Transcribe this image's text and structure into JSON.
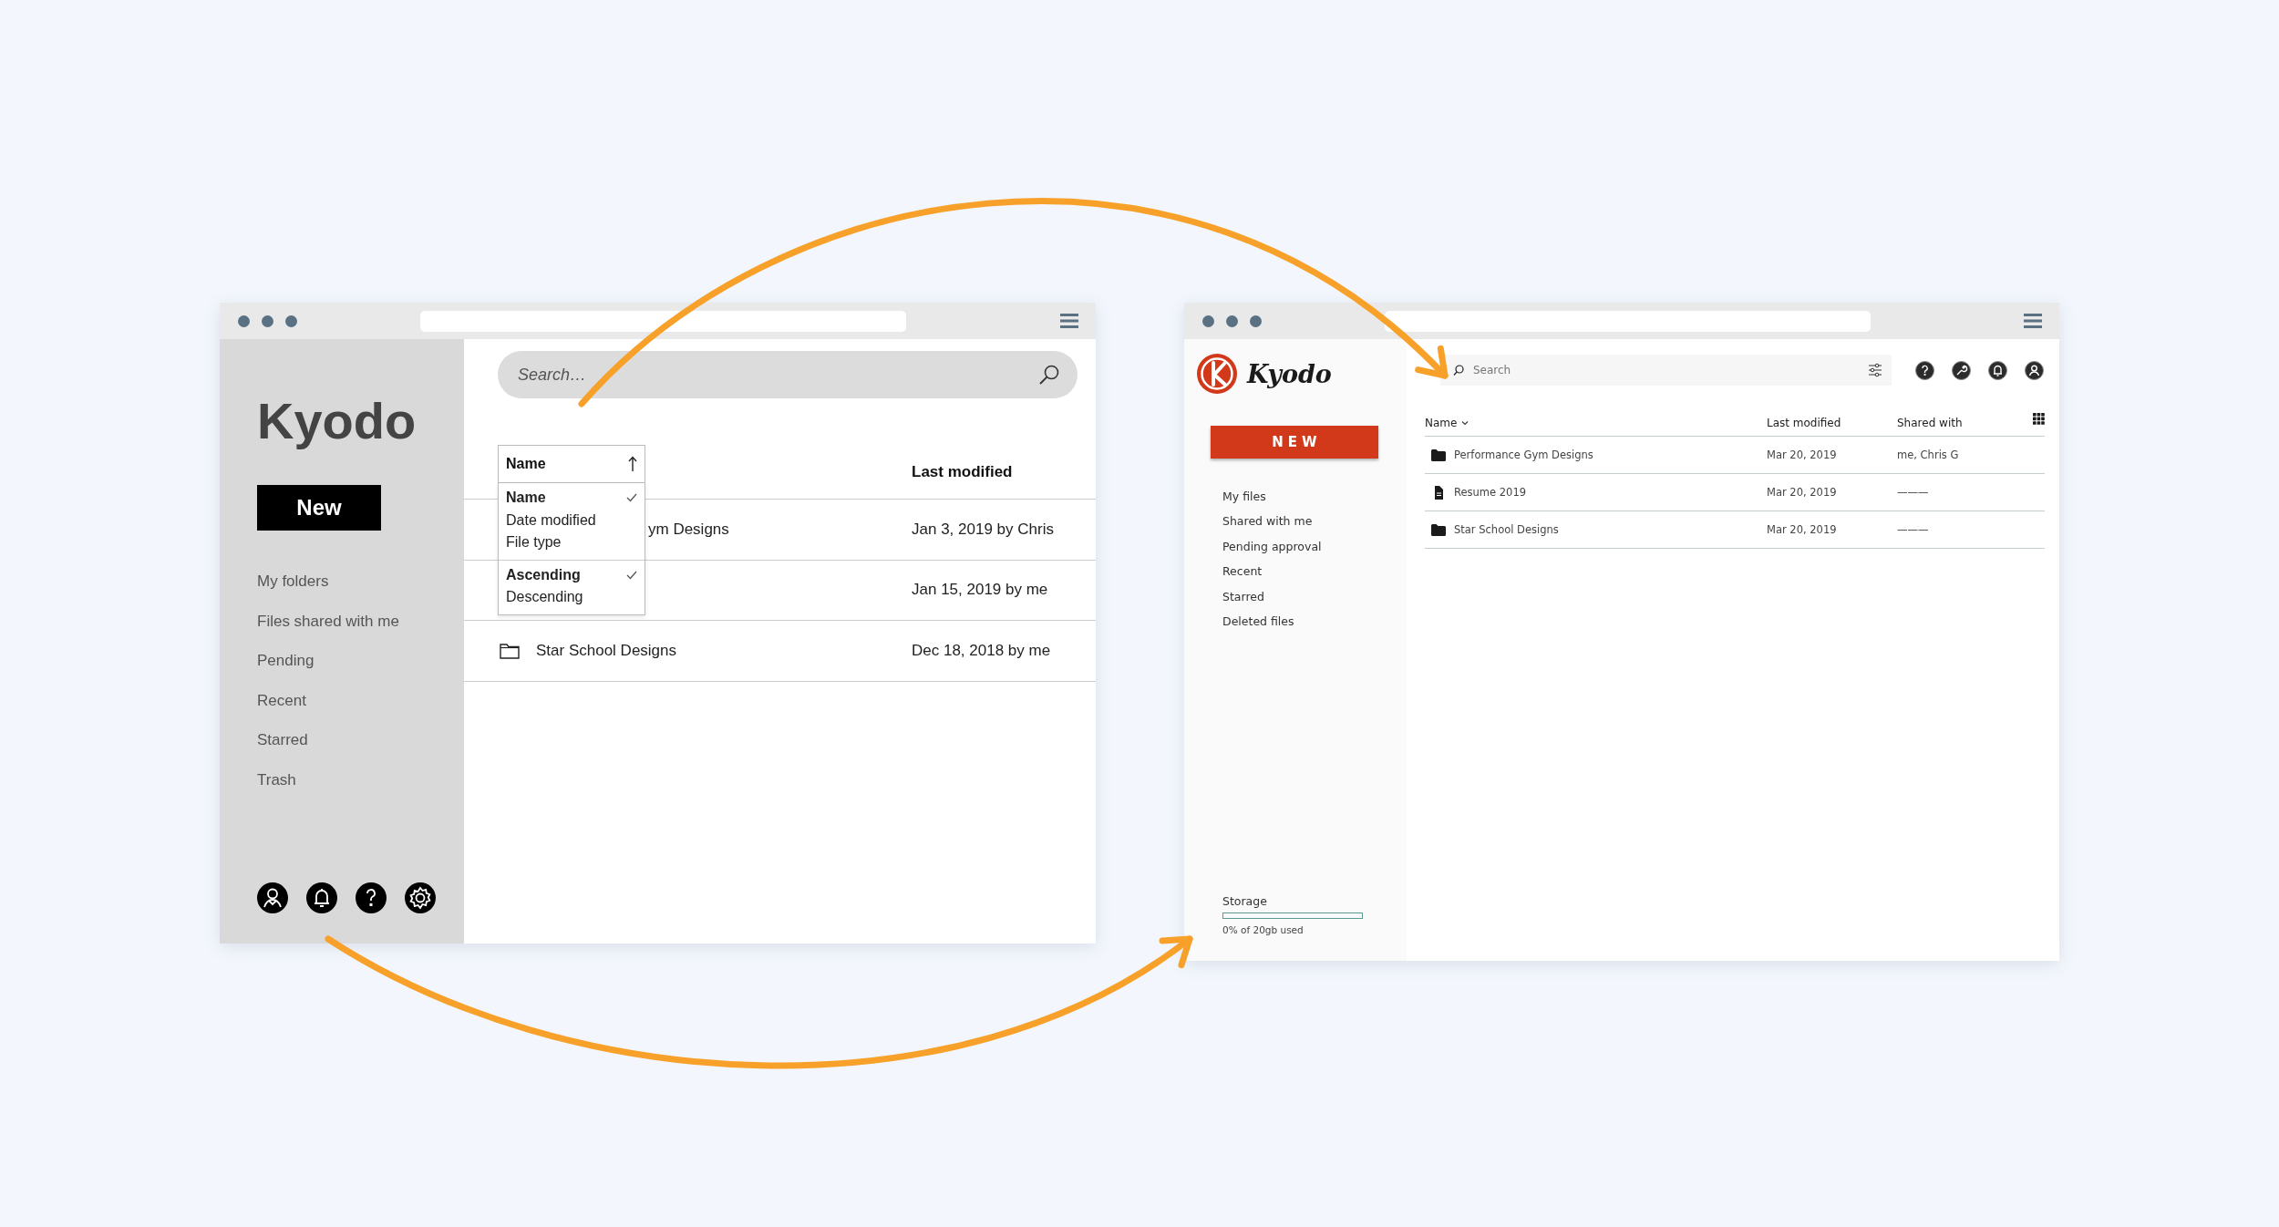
{
  "left_app": {
    "logo": "Kyodo",
    "new_button": "New",
    "search": {
      "placeholder": "Search…"
    },
    "nav": [
      {
        "label": "My folders"
      },
      {
        "label": "Files shared with me"
      },
      {
        "label": "Pending"
      },
      {
        "label": "Recent"
      },
      {
        "label": "Starred"
      },
      {
        "label": "Trash"
      }
    ],
    "columns": {
      "last_modified": "Last modified"
    },
    "sort_menu": {
      "label": "Name",
      "fields": [
        {
          "label": "Name",
          "checked": true
        },
        {
          "label": "Date modified",
          "checked": false
        },
        {
          "label": "File type",
          "checked": false
        }
      ],
      "orders": [
        {
          "label": "Ascending",
          "checked": true
        },
        {
          "label": "Descending",
          "checked": false
        }
      ]
    },
    "rows": [
      {
        "covered": true,
        "name": "ym Designs",
        "modified": "Jan 3, 2019 by Chris"
      },
      {
        "modified": "Jan 15, 2019 by me"
      },
      {
        "covered": false,
        "name": "Star School Designs",
        "modified": "Dec 18, 2018 by me"
      }
    ]
  },
  "right_app": {
    "logo": "Kyodo",
    "new_button": "NEW",
    "search": {
      "placeholder": "Search"
    },
    "nav": [
      {
        "label": "My files"
      },
      {
        "label": "Shared with me"
      },
      {
        "label": "Pending approval"
      },
      {
        "label": "Recent"
      },
      {
        "label": "Starred"
      },
      {
        "label": "Deleted files"
      }
    ],
    "storage": {
      "label": "Storage",
      "level": 0,
      "reading": "0% of 20gb used"
    },
    "columns": [
      "Name",
      "Last modified",
      "Shared with"
    ],
    "rows": [
      {
        "kind": "folder",
        "name": "Performance Gym Designs",
        "modified": "Mar 20, 2019",
        "shared": "me, Chris G"
      },
      {
        "kind": "file",
        "name": "Resume 2019",
        "modified": "Mar 20, 2019",
        "shared": "———"
      },
      {
        "kind": "folder",
        "name": "Star School Designs",
        "modified": "Mar 20, 2019",
        "shared": "———"
      }
    ]
  }
}
